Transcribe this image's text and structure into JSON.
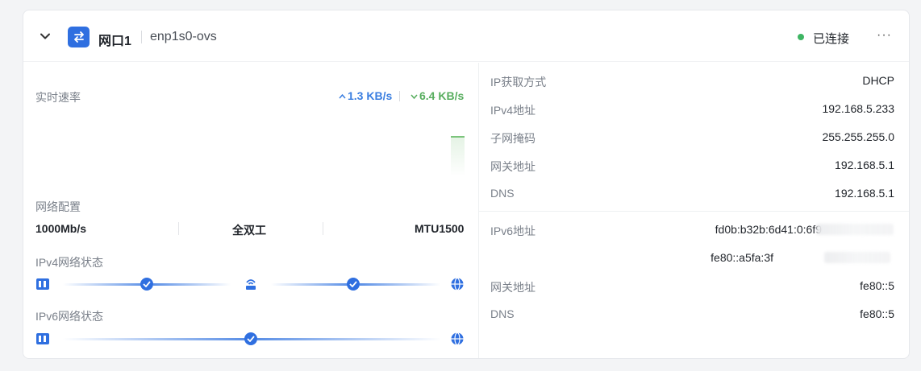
{
  "header": {
    "port_name": "网口1",
    "interface": "enp1s0-ovs",
    "status": "已连接",
    "more": "···"
  },
  "realtime": {
    "label": "实时速率",
    "upload": "1.3 KB/s",
    "download": "6.4 KB/s"
  },
  "network_config": {
    "label": "网络配置",
    "speed": "1000Mb/s",
    "duplex": "全双工",
    "mtu": "MTU1500"
  },
  "ipv4_status": {
    "label": "IPv4网络状态"
  },
  "ipv6_status": {
    "label": "IPv6网络状态"
  },
  "details_ipv4": [
    {
      "label": "IP获取方式",
      "value": "DHCP"
    },
    {
      "label": "IPv4地址",
      "value": "192.168.5.233"
    },
    {
      "label": "子网掩码",
      "value": "255.255.255.0"
    },
    {
      "label": "网关地址",
      "value": "192.168.5.1"
    },
    {
      "label": "DNS",
      "value": "192.168.5.1"
    }
  ],
  "details_ipv6": {
    "ipv6_label": "IPv6地址",
    "ipv6_value_1": "fd0b:b32b:6d41:0:6f9",
    "ipv6_value_2": "fe80::a5fa:3f",
    "gateway_label": "网关地址",
    "gateway_value": "fe80::5",
    "dns_label": "DNS",
    "dns_value": "fe80::5"
  },
  "colors": {
    "accent": "#2f6fe0",
    "upload": "#3a7ee0",
    "download": "#57ad5e",
    "connected": "#3eb563"
  }
}
